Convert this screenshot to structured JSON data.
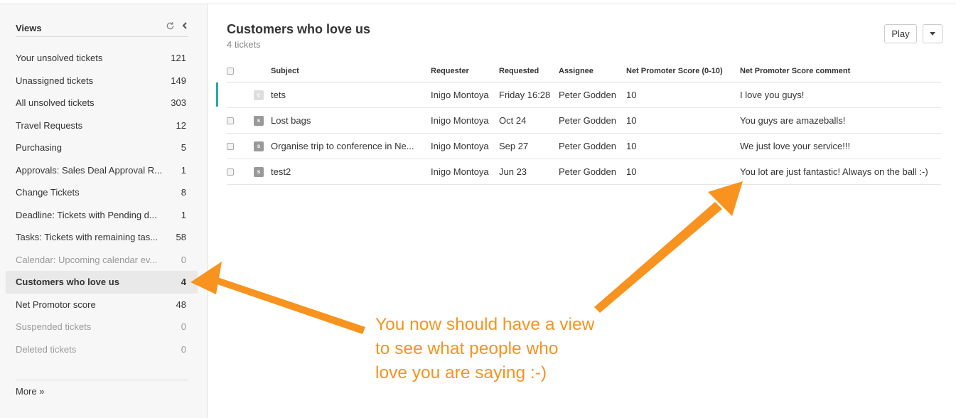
{
  "sidebar": {
    "title": "Views",
    "refresh_icon": "refresh-icon",
    "collapse_icon": "chevron-left-icon",
    "items": [
      {
        "label": "Your unsolved tickets",
        "count": "121",
        "state": "normal"
      },
      {
        "label": "Unassigned tickets",
        "count": "149",
        "state": "normal"
      },
      {
        "label": "All unsolved tickets",
        "count": "303",
        "state": "normal"
      },
      {
        "label": "Travel Requests",
        "count": "12",
        "state": "normal"
      },
      {
        "label": "Purchasing",
        "count": "5",
        "state": "normal"
      },
      {
        "label": "Approvals: Sales Deal Approval R...",
        "count": "1",
        "state": "normal"
      },
      {
        "label": "Change Tickets",
        "count": "8",
        "state": "normal"
      },
      {
        "label": "Deadline: Tickets with Pending d...",
        "count": "1",
        "state": "normal"
      },
      {
        "label": "Tasks: Tickets with remaining tas...",
        "count": "58",
        "state": "normal"
      },
      {
        "label": "Calendar: Upcoming calendar ev...",
        "count": "0",
        "state": "muted"
      },
      {
        "label": "Customers who love us",
        "count": "4",
        "state": "active"
      },
      {
        "label": "Net Promotor score",
        "count": "48",
        "state": "normal"
      },
      {
        "label": "Suspended tickets",
        "count": "0",
        "state": "muted"
      },
      {
        "label": "Deleted tickets",
        "count": "0",
        "state": "muted"
      }
    ],
    "more_label": "More »"
  },
  "main": {
    "title": "Customers who love us",
    "subtitle": "4 tickets",
    "play_label": "Play",
    "dropdown_icon": "caret-down-icon"
  },
  "table": {
    "columns": [
      "Subject",
      "Requester",
      "Requested",
      "Assignee",
      "Net Promoter Score (0-10)",
      "Net Promoter Score comment"
    ],
    "rows": [
      {
        "badge": "c",
        "subject": "tets",
        "requester": "Inigo Montoya",
        "requested": "Friday 16:28",
        "assignee": "Peter Godden",
        "score": "10",
        "comment": "I love you guys!",
        "selected": true
      },
      {
        "badge": "s",
        "subject": "Lost bags",
        "requester": "Inigo Montoya",
        "requested": "Oct 24",
        "assignee": "Peter Godden",
        "score": "10",
        "comment": "You guys are amazeballs!",
        "selected": false
      },
      {
        "badge": "s",
        "subject": "Organise trip to conference in Ne...",
        "requester": "Inigo Montoya",
        "requested": "Sep 27",
        "assignee": "Peter Godden",
        "score": "10",
        "comment": "We just love your service!!!",
        "selected": false
      },
      {
        "badge": "s",
        "subject": "test2",
        "requester": "Inigo Montoya",
        "requested": "Jun 23",
        "assignee": "Peter Godden",
        "score": "10",
        "comment": "You lot are just fantastic! Always on the ball :-)",
        "selected": false
      }
    ]
  },
  "annotation": {
    "lines": [
      "You now should have a view",
      "to see what people who",
      "love you are saying :-)"
    ],
    "color": "#f7931e"
  },
  "colors": {
    "accent": "#2aa7a7",
    "annotation": "#f7931e"
  }
}
